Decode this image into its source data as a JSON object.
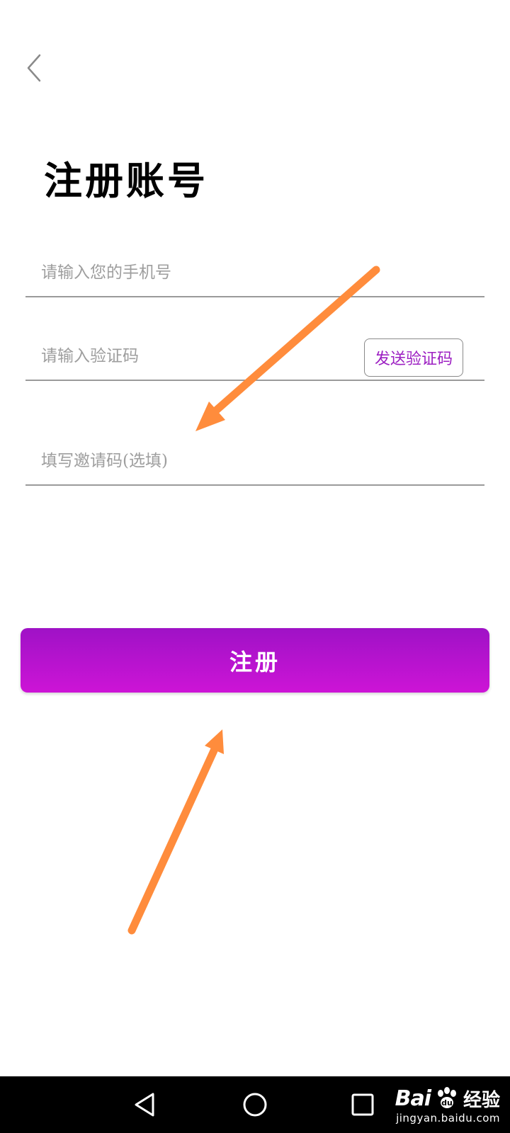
{
  "header": {
    "back_icon": "chevron-left-icon"
  },
  "page": {
    "title": "注册账号"
  },
  "form": {
    "phone_placeholder": "请输入您的手机号",
    "code_placeholder": "请输入验证码",
    "send_code_label": "发送验证码",
    "invite_placeholder": "填写邀请码(选填)",
    "register_label": "注册"
  },
  "colors": {
    "accent": "#b010cc",
    "send_code_text": "#9c1fc2",
    "annotation_arrow": "#ff8c3c"
  },
  "annotations": {
    "arrow_icon": "orange-arrow-icon"
  },
  "nav": {
    "back_icon": "triangle-back-icon",
    "home_icon": "circle-home-icon",
    "recent_icon": "square-recent-icon"
  },
  "watermark": {
    "brand_text": "Bai",
    "brand_suffix": "经验",
    "url": "jingyan.baidu.com"
  }
}
